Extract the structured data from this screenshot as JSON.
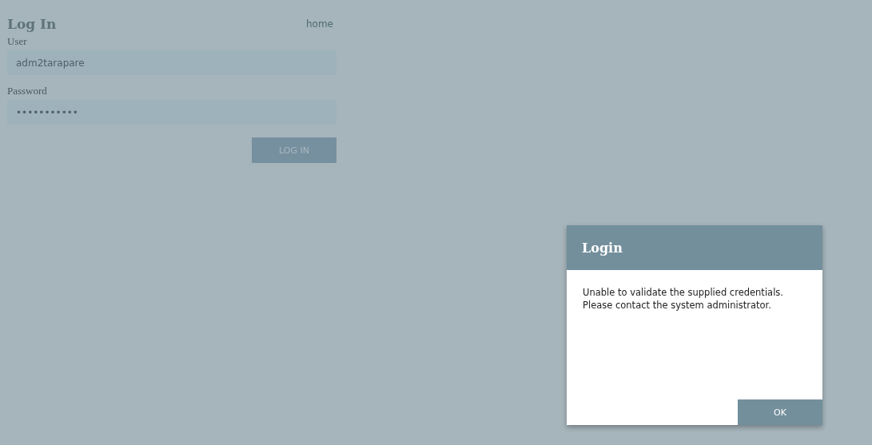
{
  "form": {
    "title": "Log In",
    "home_link": "home",
    "fields": [
      {
        "label": "User",
        "value": "adm2tarapare"
      },
      {
        "label": "Password",
        "value": "•••••••••••"
      }
    ],
    "submit_button": "LOG IN"
  },
  "dialog": {
    "title": "Login",
    "message": "Unable to validate the supplied credentials.\nPlease contact the system administrator.",
    "button": "OK"
  }
}
